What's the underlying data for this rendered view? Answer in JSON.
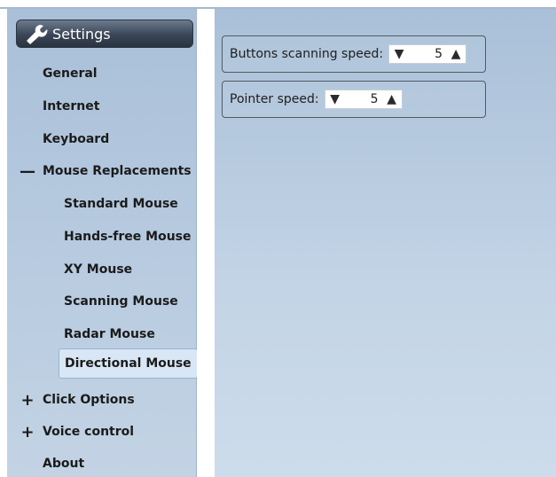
{
  "header": {
    "title": "Settings"
  },
  "sidebar": {
    "items": [
      {
        "label": "General"
      },
      {
        "label": "Internet"
      },
      {
        "label": "Keyboard"
      },
      {
        "label": "Mouse Replacements",
        "sign": "—"
      },
      {
        "label": "Standard Mouse"
      },
      {
        "label": "Hands-free Mouse"
      },
      {
        "label": "XY Mouse"
      },
      {
        "label": "Scanning Mouse"
      },
      {
        "label": "Radar Mouse"
      },
      {
        "label": "Directional Mouse",
        "selected": true
      },
      {
        "label": "Click Options",
        "sign": "+"
      },
      {
        "label": "Voice control",
        "sign": "+"
      },
      {
        "label": "About"
      }
    ]
  },
  "main": {
    "buttons_speed": {
      "label": "Buttons scanning speed:",
      "value": "5"
    },
    "pointer_speed": {
      "label": "Pointer speed:",
      "value": "5"
    }
  }
}
